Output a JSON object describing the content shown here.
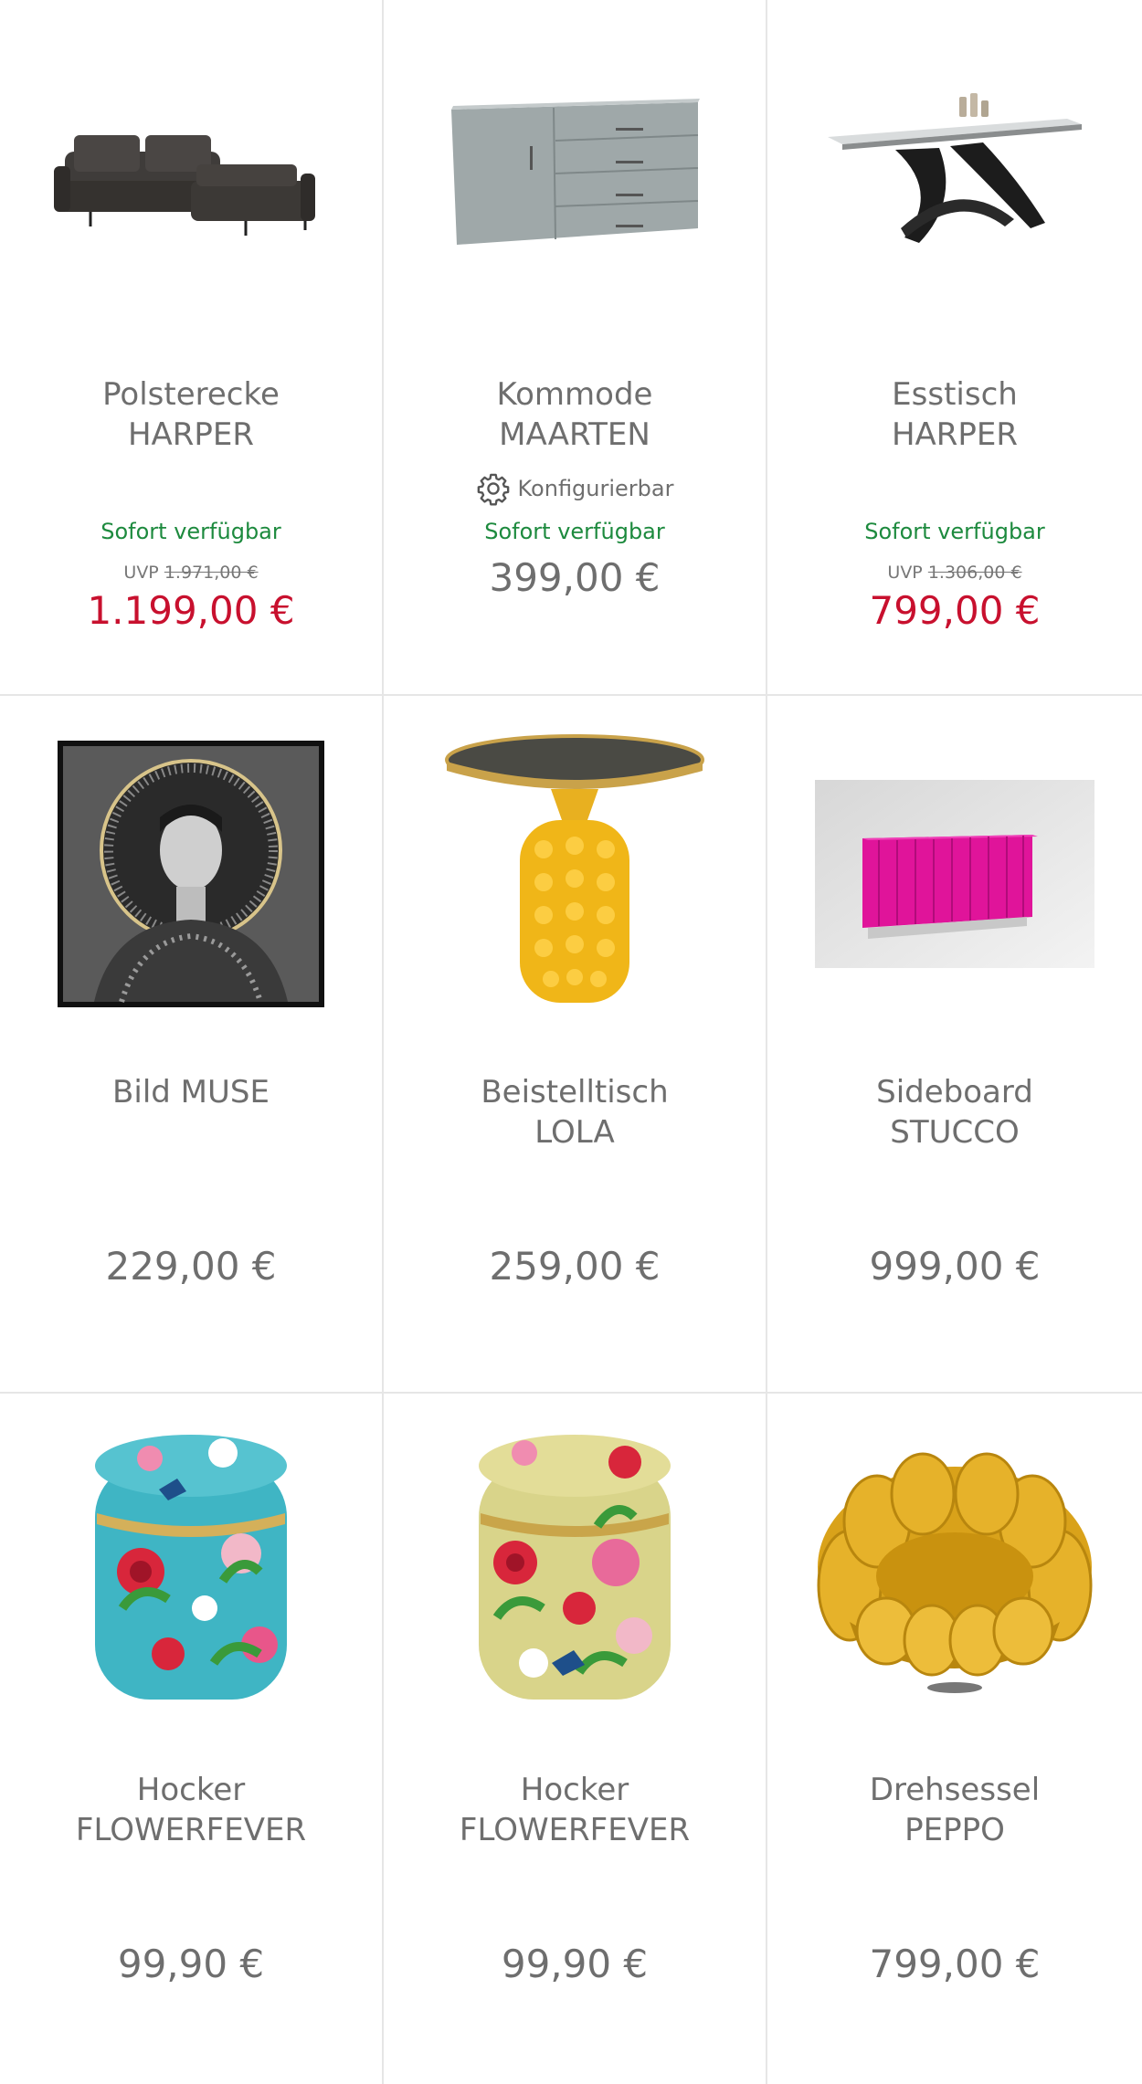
{
  "products": [
    {
      "title_1": "Polsterecke",
      "title_2": "HARPER",
      "availability": "Sofort verfügbar",
      "uvp_label": "UVP",
      "uvp_value": "1.971,00 €",
      "price": "1.199,00 €",
      "image": "sofa-image"
    },
    {
      "title_1": "Kommode",
      "title_2": "MAARTEN",
      "configurable": "Konfigurierbar",
      "availability": "Sofort verfügbar",
      "price": "399,00 €",
      "image": "dresser-image"
    },
    {
      "title_1": "Esstisch",
      "title_2": "HARPER",
      "availability": "Sofort verfügbar",
      "uvp_label": "UVP",
      "uvp_value": "1.306,00 €",
      "price": "799,00 €",
      "image": "dining-table-image"
    },
    {
      "title_1": "Bild MUSE",
      "price": "229,00 €",
      "image": "muse-picture-image"
    },
    {
      "title_1": "Beistelltisch",
      "title_2": "LOLA",
      "price": "259,00 €",
      "image": "side-table-image"
    },
    {
      "title_1": "Sideboard",
      "title_2": "STUCCO",
      "price": "999,00 €",
      "image": "sideboard-image"
    },
    {
      "title_1": "Hocker",
      "title_2": "FLOWERFEVER",
      "price": "99,90 €",
      "image": "stool-blue-image"
    },
    {
      "title_1": "Hocker",
      "title_2": "FLOWERFEVER",
      "price": "99,90 €",
      "image": "stool-yellow-image"
    },
    {
      "title_1": "Drehsessel",
      "title_2": "PEPPO",
      "price": "799,00 €",
      "image": "armchair-image"
    }
  ],
  "colors": {
    "sale_red": "#c8102e",
    "availability_green": "#1d8a3e",
    "text_gray": "#6e6e6e",
    "divider": "#e6e6e6"
  },
  "icons": {
    "configurable": "gear-icon"
  }
}
